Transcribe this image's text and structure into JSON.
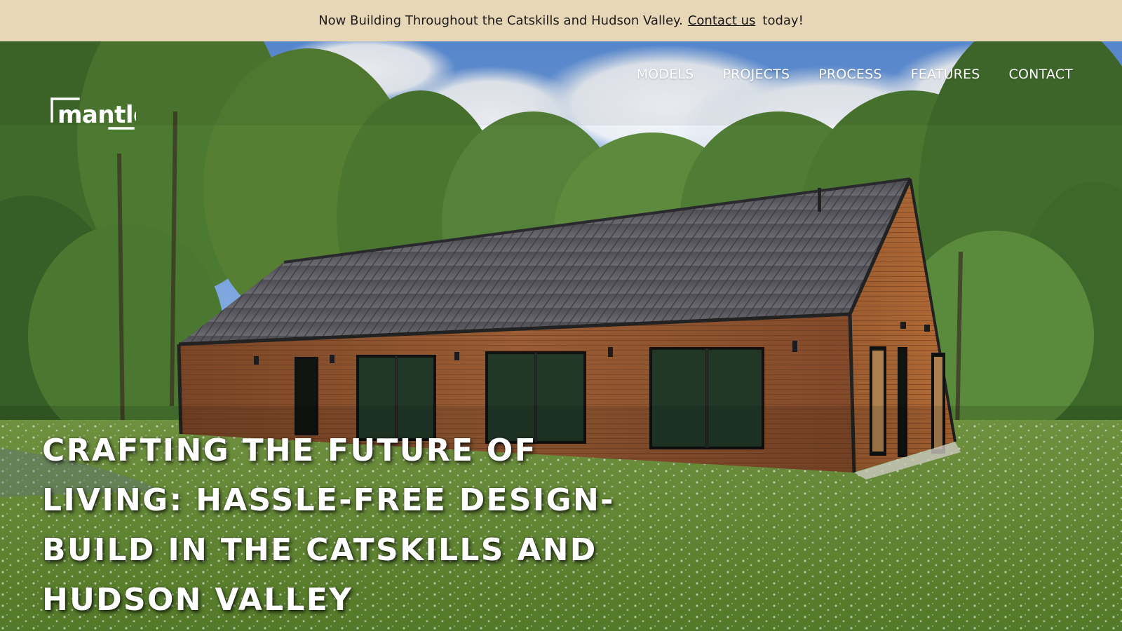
{
  "announcement": {
    "text_before": "Now Building Throughout the Catskills and Hudson Valley.",
    "link_text": "Contact us",
    "text_after": "today!"
  },
  "brand": {
    "logo_alt": "mantle"
  },
  "nav": {
    "items": [
      {
        "label": "MODELS"
      },
      {
        "label": "PROJECTS"
      },
      {
        "label": "PROCESS"
      },
      {
        "label": "FEATURES"
      },
      {
        "label": "CONTACT"
      }
    ]
  },
  "hero": {
    "headline": "CRAFTING THE FUTURE OF LIVING: HASSLE-FREE DESIGN-BUILD IN THE CATSKILLS AND HUDSON VALLEY",
    "image_subject": "modern wood-clad home with metal roof in green field"
  },
  "colors": {
    "announcement_bg": "#e8d7b7",
    "text_dark": "#1b1b1b",
    "nav_text": "#ffffff",
    "roof": "#5b5b60",
    "siding": "#8a5230",
    "grass": "#6f9a3a",
    "sky": "#7fa9de"
  }
}
